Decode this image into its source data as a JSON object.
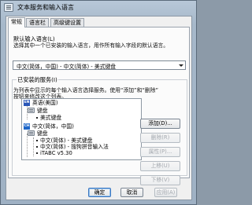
{
  "window": {
    "title": "文本服务和输入语言"
  },
  "tabs": [
    {
      "label": "常规",
      "active": true
    },
    {
      "label": "语言栏",
      "active": false
    },
    {
      "label": "高级键设置",
      "active": false
    }
  ],
  "default_language": {
    "title": "默认输入语言(L)",
    "description": "选择其中一个已安装的输入语言，用作所有输入字段的默认语言。",
    "selected_value": "中文(简体，中国) - 中文(简体) - 美式键盘"
  },
  "installed_services": {
    "title": "已安装的服务(I)",
    "description_line1": "为列表中显示的每个输入语言选择服务。使用“添加”和“删除”",
    "description_line2": "按钮来修改这个列表。",
    "tree": {
      "en_badge": "EN",
      "en_language": "英语(美国)",
      "en_keyboard_category": "键盘",
      "en_keyboard_item": "美式键盘",
      "ch_badge": "CH",
      "ch_language": "中文(简体，中国)",
      "ch_keyboard_category": "键盘",
      "ch_items": [
        "中文(简体) - 美式键盘",
        "中文(简体) - 搜狗拼音输入法",
        "iTABC v5.30"
      ]
    },
    "buttons": {
      "add": "添加(D)...",
      "remove": "删除(R)",
      "properties": "属性(P)...",
      "move_up": "上移(U)",
      "move_down": "下移(V)"
    }
  },
  "footer": {
    "ok": "确定",
    "cancel": "取消",
    "apply": "应用(A)"
  }
}
